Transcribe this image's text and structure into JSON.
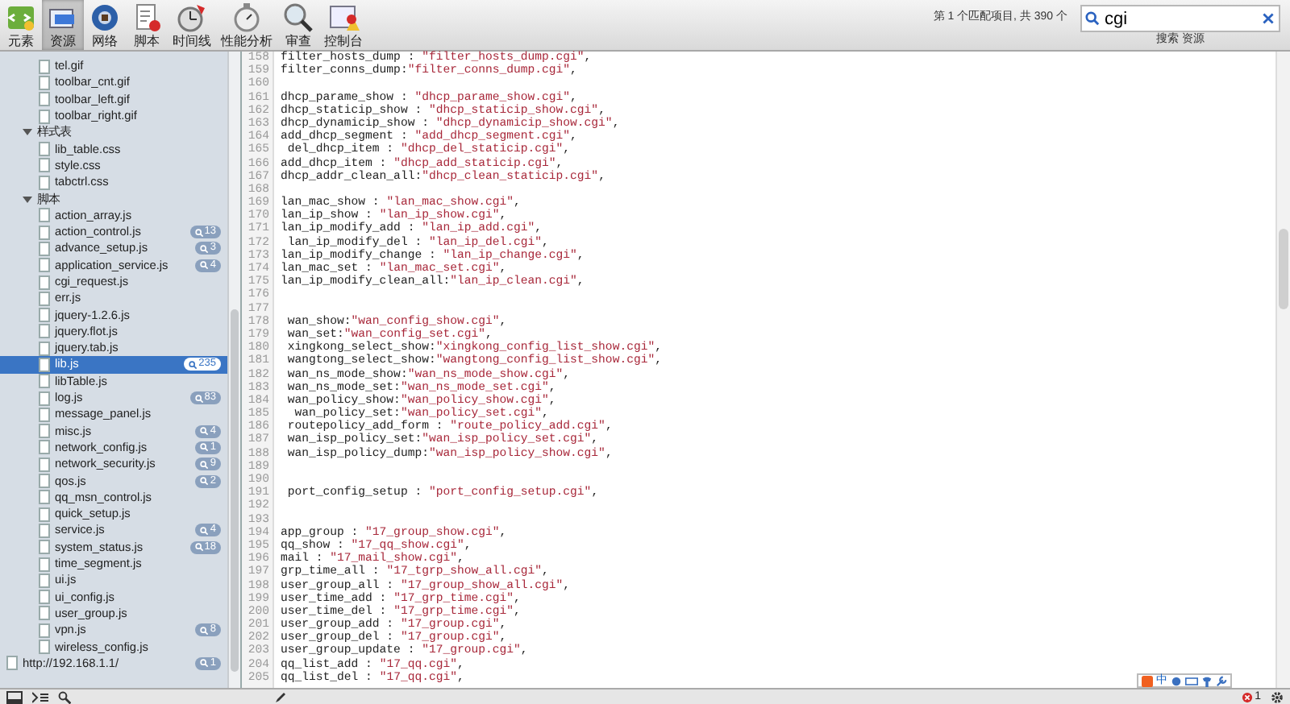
{
  "toolbar": {
    "tabs": [
      {
        "label": "元素",
        "selected": false
      },
      {
        "label": "资源",
        "selected": true
      },
      {
        "label": "网络",
        "selected": false
      },
      {
        "label": "脚本",
        "selected": false
      },
      {
        "label": "时间线",
        "selected": false
      },
      {
        "label": "性能分析",
        "selected": false
      },
      {
        "label": "审查",
        "selected": false
      },
      {
        "label": "控制台",
        "selected": false
      }
    ],
    "match_status": "第 1 个匹配项目, 共 390 个",
    "search": {
      "value": "cgi",
      "hint": "搜索 资源"
    }
  },
  "sidebar": {
    "tree": [
      {
        "children": [
          {
            "children": [
              {
                "label": "tel.gif",
                "selected": false
              },
              {
                "label": "toolbar_cnt.gif",
                "selected": false
              },
              {
                "label": "toolbar_left.gif",
                "selected": false
              },
              {
                "label": "toolbar_right.gif",
                "selected": false
              }
            ]
          },
          {
            "label": "样式表",
            "expanded": true,
            "children": [
              {
                "label": "lib_table.css",
                "selected": false
              },
              {
                "label": "style.css",
                "selected": false
              },
              {
                "label": "tabctrl.css",
                "selected": false
              }
            ]
          },
          {
            "label": "脚本",
            "expanded": true,
            "children": [
              {
                "label": "action_array.js",
                "selected": false
              },
              {
                "label": "action_control.js",
                "badge": "13",
                "selected": false
              },
              {
                "label": "advance_setup.js",
                "badge": "3",
                "selected": false
              },
              {
                "label": "application_service.js",
                "badge": "4",
                "selected": false
              },
              {
                "label": "cgi_request.js",
                "selected": false
              },
              {
                "label": "err.js",
                "selected": false
              },
              {
                "label": "jquery-1.2.6.js",
                "selected": false
              },
              {
                "label": "jquery.flot.js",
                "selected": false
              },
              {
                "label": "jquery.tab.js",
                "selected": false
              },
              {
                "label": "lib.js",
                "badge": "235",
                "selected": true
              },
              {
                "label": "libTable.js",
                "selected": false
              },
              {
                "label": "log.js",
                "badge": "83",
                "selected": false
              },
              {
                "label": "message_panel.js",
                "selected": false
              },
              {
                "label": "misc.js",
                "badge": "4",
                "selected": false
              },
              {
                "label": "network_config.js",
                "badge": "1",
                "selected": false
              },
              {
                "label": "network_security.js",
                "badge": "9",
                "selected": false
              },
              {
                "label": "qos.js",
                "badge": "2",
                "selected": false
              },
              {
                "label": "qq_msn_control.js",
                "selected": false
              },
              {
                "label": "quick_setup.js",
                "selected": false
              },
              {
                "label": "service.js",
                "badge": "4",
                "selected": false
              },
              {
                "label": "system_status.js",
                "badge": "18",
                "selected": false
              },
              {
                "label": "time_segment.js",
                "selected": false
              },
              {
                "label": "ui.js",
                "selected": false
              },
              {
                "label": "ui_config.js",
                "selected": false
              },
              {
                "label": "user_group.js",
                "selected": false
              },
              {
                "label": "vpn.js",
                "badge": "8",
                "selected": false
              },
              {
                "label": "wireless_config.js",
                "selected": false
              }
            ]
          }
        ]
      },
      {
        "label": "http://192.168.1.1/",
        "badge": "1",
        "selected": false
      }
    ]
  },
  "editor": {
    "lines": [
      {
        "number": "158",
        "code": "filter_hosts_dump : ",
        "string": "\"filter_hosts_dump.cgi\"",
        "end": ","
      },
      {
        "number": "159",
        "code": "filter_conns_dump:",
        "string": "\"filter_conns_dump.cgi\"",
        "end": ","
      },
      {
        "number": "160"
      },
      {
        "number": "161",
        "code": "dhcp_parame_show : ",
        "string": "\"dhcp_parame_show.cgi\"",
        "end": ","
      },
      {
        "number": "162",
        "code": "dhcp_staticip_show : ",
        "string": "\"dhcp_staticip_show.cgi\"",
        "end": ","
      },
      {
        "number": "163",
        "code": "dhcp_dynamicip_show : ",
        "string": "\"dhcp_dynamicip_show.cgi\"",
        "end": ","
      },
      {
        "number": "164",
        "code": "add_dhcp_segment : ",
        "string": "\"add_dhcp_segment.cgi\"",
        "end": ","
      },
      {
        "number": "165",
        "code": " del_dhcp_item : ",
        "string": "\"dhcp_del_staticip.cgi\"",
        "end": ","
      },
      {
        "number": "166",
        "code": "add_dhcp_item : ",
        "string": "\"dhcp_add_staticip.cgi\"",
        "end": ","
      },
      {
        "number": "167",
        "code": "dhcp_addr_clean_all:",
        "string": "\"dhcp_clean_staticip.cgi\"",
        "end": ","
      },
      {
        "number": "168"
      },
      {
        "number": "169",
        "code": "lan_mac_show : ",
        "string": "\"lan_mac_show.cgi\"",
        "end": ","
      },
      {
        "number": "170",
        "code": "lan_ip_show : ",
        "string": "\"lan_ip_show.cgi\"",
        "end": ","
      },
      {
        "number": "171",
        "code": "lan_ip_modify_add : ",
        "string": "\"lan_ip_add.cgi\"",
        "end": ","
      },
      {
        "number": "172",
        "code": " lan_ip_modify_del : ",
        "string": "\"lan_ip_del.cgi\"",
        "end": ","
      },
      {
        "number": "173",
        "code": "lan_ip_modify_change : ",
        "string": "\"lan_ip_change.cgi\"",
        "end": ","
      },
      {
        "number": "174",
        "code": "lan_mac_set : ",
        "string": "\"lan_mac_set.cgi\"",
        "end": ","
      },
      {
        "number": "175",
        "code": "lan_ip_modify_clean_all:",
        "string": "\"lan_ip_clean.cgi\"",
        "end": ","
      },
      {
        "number": "176"
      },
      {
        "number": "177"
      },
      {
        "number": "178",
        "code": " wan_show:",
        "string": "\"wan_config_show.cgi\"",
        "end": ","
      },
      {
        "number": "179",
        "code": " wan_set:",
        "string": "\"wan_config_set.cgi\"",
        "end": ","
      },
      {
        "number": "180",
        "code": " xingkong_select_show:",
        "string": "\"xingkong_config_list_show.cgi\"",
        "end": ","
      },
      {
        "number": "181",
        "code": " wangtong_select_show:",
        "string": "\"wangtong_config_list_show.cgi\"",
        "end": ","
      },
      {
        "number": "182",
        "code": " wan_ns_mode_show:",
        "string": "\"wan_ns_mode_show.cgi\"",
        "end": ","
      },
      {
        "number": "183",
        "code": " wan_ns_mode_set:",
        "string": "\"wan_ns_mode_set.cgi\"",
        "end": ","
      },
      {
        "number": "184",
        "code": " wan_policy_show:",
        "string": "\"wan_policy_show.cgi\"",
        "end": ","
      },
      {
        "number": "185",
        "code": "  wan_policy_set:",
        "string": "\"wan_policy_set.cgi\"",
        "end": ","
      },
      {
        "number": "186",
        "code": " routepolicy_add_form : ",
        "string": "\"route_policy_add.cgi\"",
        "end": ","
      },
      {
        "number": "187",
        "code": " wan_isp_policy_set:",
        "string": "\"wan_isp_policy_set.cgi\"",
        "end": ","
      },
      {
        "number": "188",
        "code": " wan_isp_policy_dump:",
        "string": "\"wan_isp_policy_show.cgi\"",
        "end": ","
      },
      {
        "number": "189"
      },
      {
        "number": "190"
      },
      {
        "number": "191",
        "code": " port_config_setup : ",
        "string": "\"port_config_setup.cgi\"",
        "end": ","
      },
      {
        "number": "192"
      },
      {
        "number": "193"
      },
      {
        "number": "194",
        "code": "app_group : ",
        "string": "\"17_group_show.cgi\"",
        "end": ","
      },
      {
        "number": "195",
        "code": "qq_show : ",
        "string": "\"17_qq_show.cgi\"",
        "end": ","
      },
      {
        "number": "196",
        "code": "mail : ",
        "string": "\"17_mail_show.cgi\"",
        "end": ","
      },
      {
        "number": "197",
        "code": "grp_time_all : ",
        "string": "\"17_tgrp_show_all.cgi\"",
        "end": ","
      },
      {
        "number": "198",
        "code": "user_group_all : ",
        "string": "\"17_group_show_all.cgi\"",
        "end": ","
      },
      {
        "number": "199",
        "code": "user_time_add : ",
        "string": "\"17_grp_time.cgi\"",
        "end": ","
      },
      {
        "number": "200",
        "code": "user_time_del : ",
        "string": "\"17_grp_time.cgi\"",
        "end": ","
      },
      {
        "number": "201",
        "code": "user_group_add : ",
        "string": "\"17_group.cgi\"",
        "end": ","
      },
      {
        "number": "202",
        "code": "user_group_del : ",
        "string": "\"17_group.cgi\"",
        "end": ","
      },
      {
        "number": "203",
        "code": "user_group_update : ",
        "string": "\"17_group.cgi\"",
        "end": ","
      },
      {
        "number": "204",
        "code": "qq_list_add : ",
        "string": "\"17_qq.cgi\"",
        "end": ","
      },
      {
        "number": "205",
        "code": "qq_list_del : ",
        "string": "\"17_qq.cgi\"",
        "end": ","
      }
    ]
  },
  "status_bar": {
    "ime_label": "中",
    "error_count": "1"
  }
}
